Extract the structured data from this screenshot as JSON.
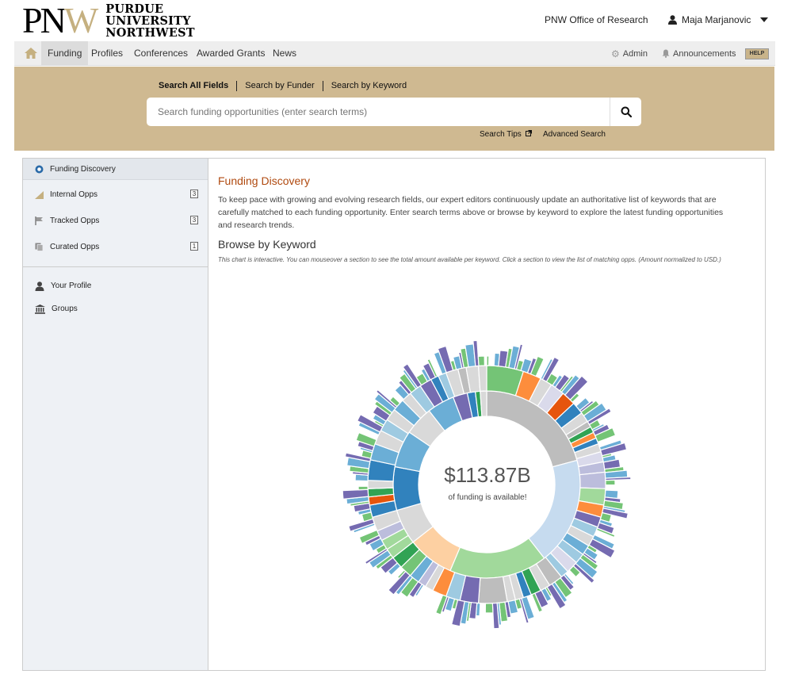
{
  "header": {
    "logo_letters": "PNW",
    "logo_line1": "PURDUE",
    "logo_line2": "UNIVERSITY",
    "logo_line3": "NORTHWEST",
    "office": "PNW Office of Research",
    "user_name": "Maja Marjanovic"
  },
  "nav": {
    "items": [
      "Funding",
      "Profiles",
      "Conferences",
      "Awarded Grants",
      "News"
    ],
    "admin": "Admin",
    "announcements": "Announcements",
    "help": "HELP"
  },
  "search": {
    "tabs": [
      "Search All Fields",
      "Search by Funder",
      "Search by Keyword"
    ],
    "placeholder": "Search funding opportunities (enter search terms)",
    "tips": "Search Tips",
    "advanced": "Advanced Search"
  },
  "sidebar": {
    "items": [
      {
        "label": "Funding Discovery",
        "badge": ""
      },
      {
        "label": "Internal Opps",
        "badge": "3"
      },
      {
        "label": "Tracked Opps",
        "badge": "3"
      },
      {
        "label": "Curated Opps",
        "badge": "1"
      },
      {
        "label": "Your Profile",
        "badge": ""
      },
      {
        "label": "Groups",
        "badge": ""
      }
    ]
  },
  "main": {
    "title": "Funding Discovery",
    "description": "To keep pace with growing and evolving research fields, our expert editors continuously update an authoritative list of keywords that are carefully matched to each funding opportunity. Enter search terms above or browse by keyword to explore the latest funding opportunities and research trends.",
    "browse_title": "Browse by Keyword",
    "note": "This chart is interactive. You can mouseover a section to see the total amount available per keyword. Click a section to view the list of matching opps. (Amount normalized to USD.)",
    "total_amount": "$113.87B",
    "total_label": "of funding is available!"
  },
  "colors": {
    "brand_gold": "#cfb991",
    "title_orange": "#b04a10",
    "ring_green": "#74c476",
    "ring_blue": "#3182bd",
    "ring_orange": "#fd8d3c",
    "ring_purple": "#756bb1",
    "ring_gray": "#bdbdbd"
  }
}
